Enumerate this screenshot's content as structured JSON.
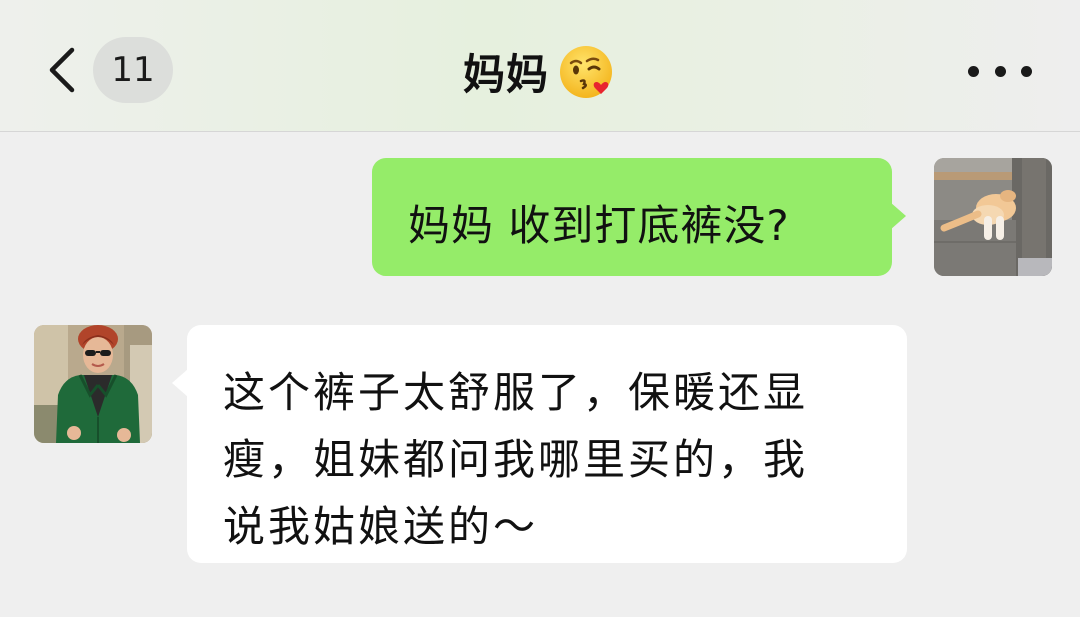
{
  "header": {
    "back_icon": "chevron-left-icon",
    "unread_count": "11",
    "title": "妈妈",
    "title_emoji": "kissing-face-with-heart-emoji",
    "more_icon": "more-dots-icon"
  },
  "messages": [
    {
      "sender": "self",
      "avatar_icon": "cat-photo-avatar",
      "text": "妈妈 收到打底裤没?"
    },
    {
      "sender": "mom",
      "avatar_icon": "woman-photo-avatar",
      "lines": [
        "这个裤子太舒服了，保暖还显",
        "瘦，姐妹都问我哪里买的，我",
        "说我姑娘送的～"
      ]
    }
  ],
  "colors": {
    "sent_bubble": "#95ec69",
    "recv_bubble": "#ffffff",
    "chat_background": "#efefef"
  }
}
